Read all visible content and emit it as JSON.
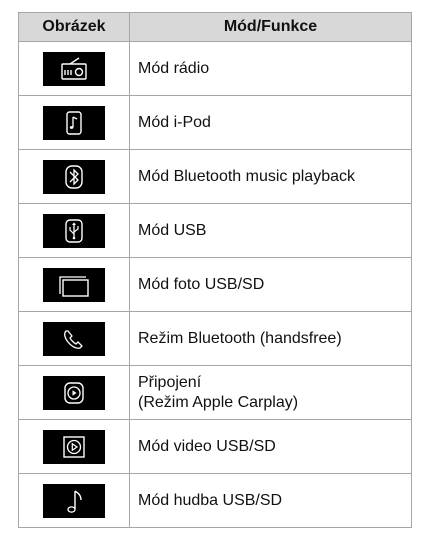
{
  "table": {
    "headers": {
      "icon": "Obrázek",
      "mode": "Mód/Funkce"
    },
    "rows": [
      {
        "icon": "radio-icon",
        "label": "Mód rádio"
      },
      {
        "icon": "ipod-icon",
        "label": "Mód i-Pod"
      },
      {
        "icon": "bluetooth-icon",
        "label": "Mód Bluetooth music playback"
      },
      {
        "icon": "usb-icon",
        "label": "Mód USB"
      },
      {
        "icon": "photo-frame-icon",
        "label": "Mód foto USB/SD"
      },
      {
        "icon": "phone-icon",
        "label": "Režim Bluetooth (handsfree)"
      },
      {
        "icon": "carplay-play-icon",
        "label": "Připojení",
        "label_line2": "(Režim Apple Carplay)"
      },
      {
        "icon": "video-play-icon",
        "label": "Mód video USB/SD"
      },
      {
        "icon": "music-note-icon",
        "label": "Mód hudba USB/SD"
      }
    ]
  },
  "colors": {
    "header_background": "#d8d8d8",
    "icon_background": "#000000",
    "icon_foreground": "#ffffff",
    "border": "#a6a6a6"
  }
}
